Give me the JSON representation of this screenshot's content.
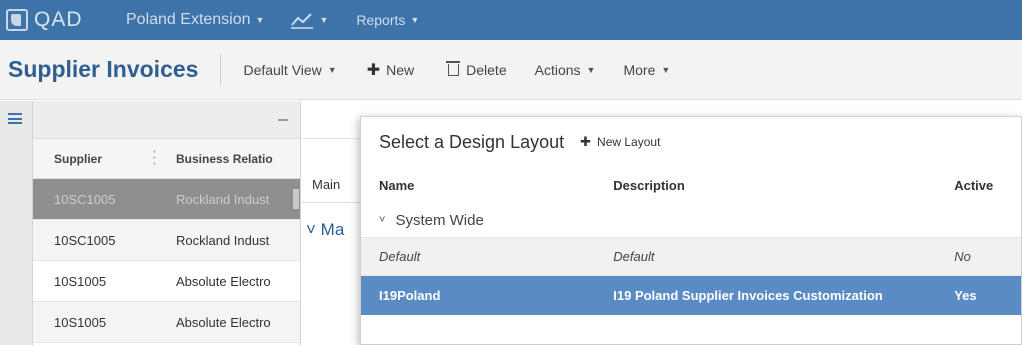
{
  "topbar": {
    "logo_text": "QAD",
    "extension_label": "Poland Extension",
    "reports_label": "Reports"
  },
  "header": {
    "title": "Supplier Invoices",
    "view_label": "Default View",
    "new_label": "New",
    "delete_label": "Delete",
    "actions_label": "Actions",
    "more_label": "More"
  },
  "grid": {
    "columns": [
      "Supplier",
      "Business Relatio"
    ],
    "rows": [
      {
        "supplier": "10SC1005",
        "relation": "Rockland Indust"
      },
      {
        "supplier": "10SC1005",
        "relation": "Rockland Indust"
      },
      {
        "supplier": "10S1005",
        "relation": "Absolute Electro"
      },
      {
        "supplier": "10S1005",
        "relation": "Absolute Electro"
      }
    ]
  },
  "detail": {
    "tab_main": "Main",
    "section_label": "Ma"
  },
  "dialog": {
    "title": "Select a Design Layout",
    "new_layout_label": "New Layout",
    "columns": {
      "name": "Name",
      "description": "Description",
      "active": "Active"
    },
    "group_label": "System Wide",
    "rows": [
      {
        "name": "Default",
        "description": "Default",
        "active": "No"
      },
      {
        "name": "I19Poland",
        "description": "I19 Poland Supplier Invoices Customization",
        "active": "Yes"
      }
    ]
  },
  "colors": {
    "nav_bg": "#3d73a8",
    "title_blue": "#2e5f8e",
    "selected_row": "#5a8bc5",
    "grid_selected": "#8f8f8f"
  }
}
